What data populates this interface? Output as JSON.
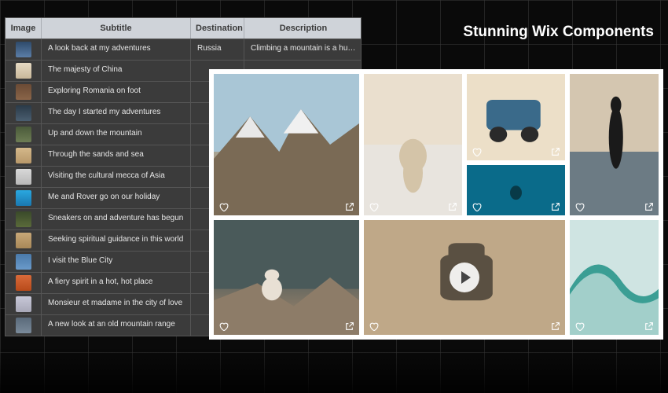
{
  "overlay_title": "Stunning Wix Components",
  "table": {
    "headers": {
      "image": "Image",
      "subtitle": "Subtitle",
      "destination": "Destination",
      "description": "Description"
    },
    "rows": [
      {
        "subtitle": "A look back at my adventures",
        "destination": "Russia",
        "description": "Climbing a mountain is a huge…",
        "thumb": "linear-gradient(#2e4a6a,#5b7ea8)"
      },
      {
        "subtitle": "The majesty of China",
        "destination": "",
        "description": "",
        "thumb": "linear-gradient(#e6dac4,#c9b89a)"
      },
      {
        "subtitle": "Exploring Romania on foot",
        "destination": "",
        "description": "",
        "thumb": "linear-gradient(#6a4a35,#8a6548)"
      },
      {
        "subtitle": "The day I started my adventures",
        "destination": "",
        "description": "",
        "thumb": "linear-gradient(#2a3a48,#4a5e70)"
      },
      {
        "subtitle": "Up and down the mountain",
        "destination": "",
        "description": "",
        "thumb": "linear-gradient(#4a5a3a,#6d7d54)"
      },
      {
        "subtitle": "Through the sands and sea",
        "destination": "",
        "description": "",
        "thumb": "linear-gradient(#d4b88a,#b8986a)"
      },
      {
        "subtitle": "Visiting the cultural mecca of Asia",
        "destination": "",
        "description": "",
        "thumb": "linear-gradient(#d8d8d8,#b8b8b8)"
      },
      {
        "subtitle": "Me and Rover go on our holiday",
        "destination": "",
        "description": "",
        "thumb": "linear-gradient(#2aa8e0,#1a78b0)"
      },
      {
        "subtitle": "Sneakers on and adventure has begun",
        "destination": "",
        "description": "",
        "thumb": "linear-gradient(#3a4a2a,#5a6a3a)"
      },
      {
        "subtitle": "Seeking spiritual guidance in this world",
        "destination": "",
        "description": "",
        "thumb": "linear-gradient(#c8a878,#a88858)"
      },
      {
        "subtitle": "I visit the Blue City",
        "destination": "",
        "description": "",
        "thumb": "linear-gradient(#4a7aaa,#6a9aca)"
      },
      {
        "subtitle": "A fiery spirit in a hot, hot place",
        "destination": "",
        "description": "",
        "thumb": "linear-gradient(#d86a3a,#b84a1a)"
      },
      {
        "subtitle": "Monsieur et madame in the city of love",
        "destination": "",
        "description": "",
        "thumb": "linear-gradient(#c8c8d8,#a8a8b8)"
      },
      {
        "subtitle": "A new look at an old mountain range",
        "destination": "",
        "description": "",
        "thumb": "linear-gradient(#5a6a7a,#7a8a9a)"
      }
    ]
  },
  "gallery": {
    "tiles": [
      {
        "key": "mountain",
        "has_play": false
      },
      {
        "key": "dog",
        "has_play": false
      },
      {
        "key": "car",
        "has_play": false
      },
      {
        "key": "diver",
        "has_play": false
      },
      {
        "key": "person",
        "has_play": false
      },
      {
        "key": "sitter",
        "has_play": false
      },
      {
        "key": "backpack",
        "has_play": true
      },
      {
        "key": "wave",
        "has_play": false
      }
    ]
  }
}
